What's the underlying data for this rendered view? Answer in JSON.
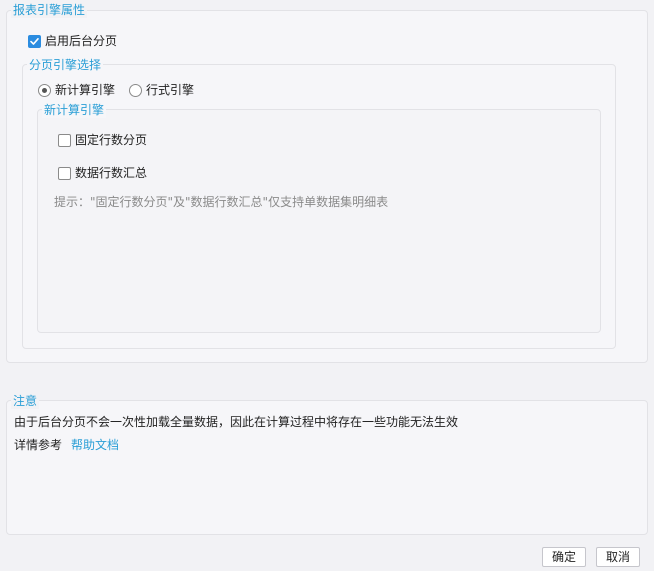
{
  "report_engine": {
    "title": "报表引擎属性",
    "enable_backend_paging": {
      "label": "启用后台分页",
      "checked": true
    },
    "paging_engine": {
      "title": "分页引擎选择",
      "options": [
        {
          "label": "新计算引擎",
          "selected": true
        },
        {
          "label": "行式引擎",
          "selected": false
        }
      ],
      "new_engine": {
        "title": "新计算引擎",
        "fixed_rows_paging": {
          "label": "固定行数分页",
          "checked": false
        },
        "rows_summary": {
          "label": "数据行数汇总",
          "checked": false
        },
        "hint": "提示：\"固定行数分页\"及\"数据行数汇总\"仅支持单数据集明细表"
      }
    }
  },
  "notice": {
    "title": "注意",
    "text": "由于后台分页不会一次性加载全量数据，因此在计算过程中将存在一些功能无法生效",
    "ref_label": "详情参考",
    "help_link": "帮助文档"
  },
  "footer": {
    "ok_label": "确定",
    "cancel_label": "取消"
  },
  "colors": {
    "accent": "#2b9fd6",
    "checkbox_checked": "#2b8ce0",
    "hint": "#8a8a8a"
  }
}
